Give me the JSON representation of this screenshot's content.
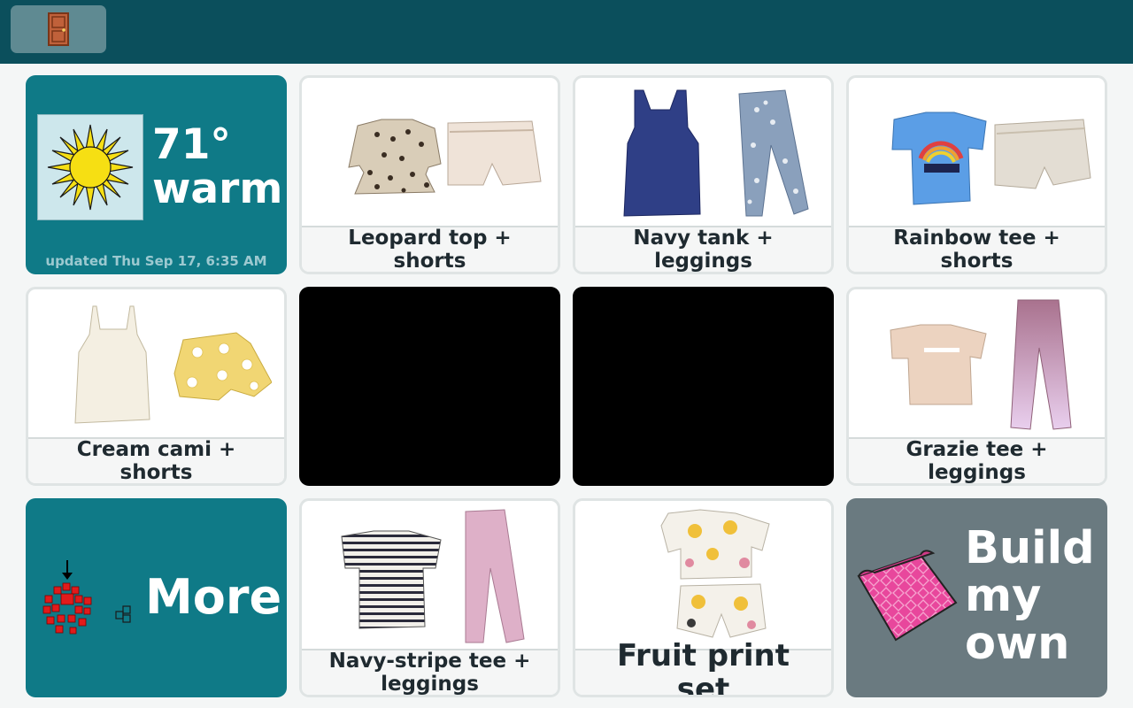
{
  "topbar": {
    "exit_icon": "door-icon"
  },
  "weather": {
    "temperature": "71°",
    "condition": "warm",
    "updated": "updated Thu Sep 17, 6:35 AM",
    "icon": "sun-icon"
  },
  "outfits": [
    {
      "label": "Leopard top + shorts"
    },
    {
      "label": "Navy tank + leggings"
    },
    {
      "label": "Rainbow tee + shorts"
    },
    {
      "label": "Cream cami + shorts"
    },
    {
      "label": "Grazie tee + leggings"
    },
    {
      "label": "Navy-stripe tee + leggings"
    },
    {
      "label": "Fruit print set"
    }
  ],
  "more": {
    "label": "More",
    "icon": "dots-grid-icon"
  },
  "build": {
    "label": "Build my own",
    "icon": "fabric-icon"
  },
  "colors": {
    "topbar": "#0b4f5c",
    "accent_tile": "#0f7a87",
    "build_tile": "#6a7a80",
    "background": "#f4f6f6"
  }
}
